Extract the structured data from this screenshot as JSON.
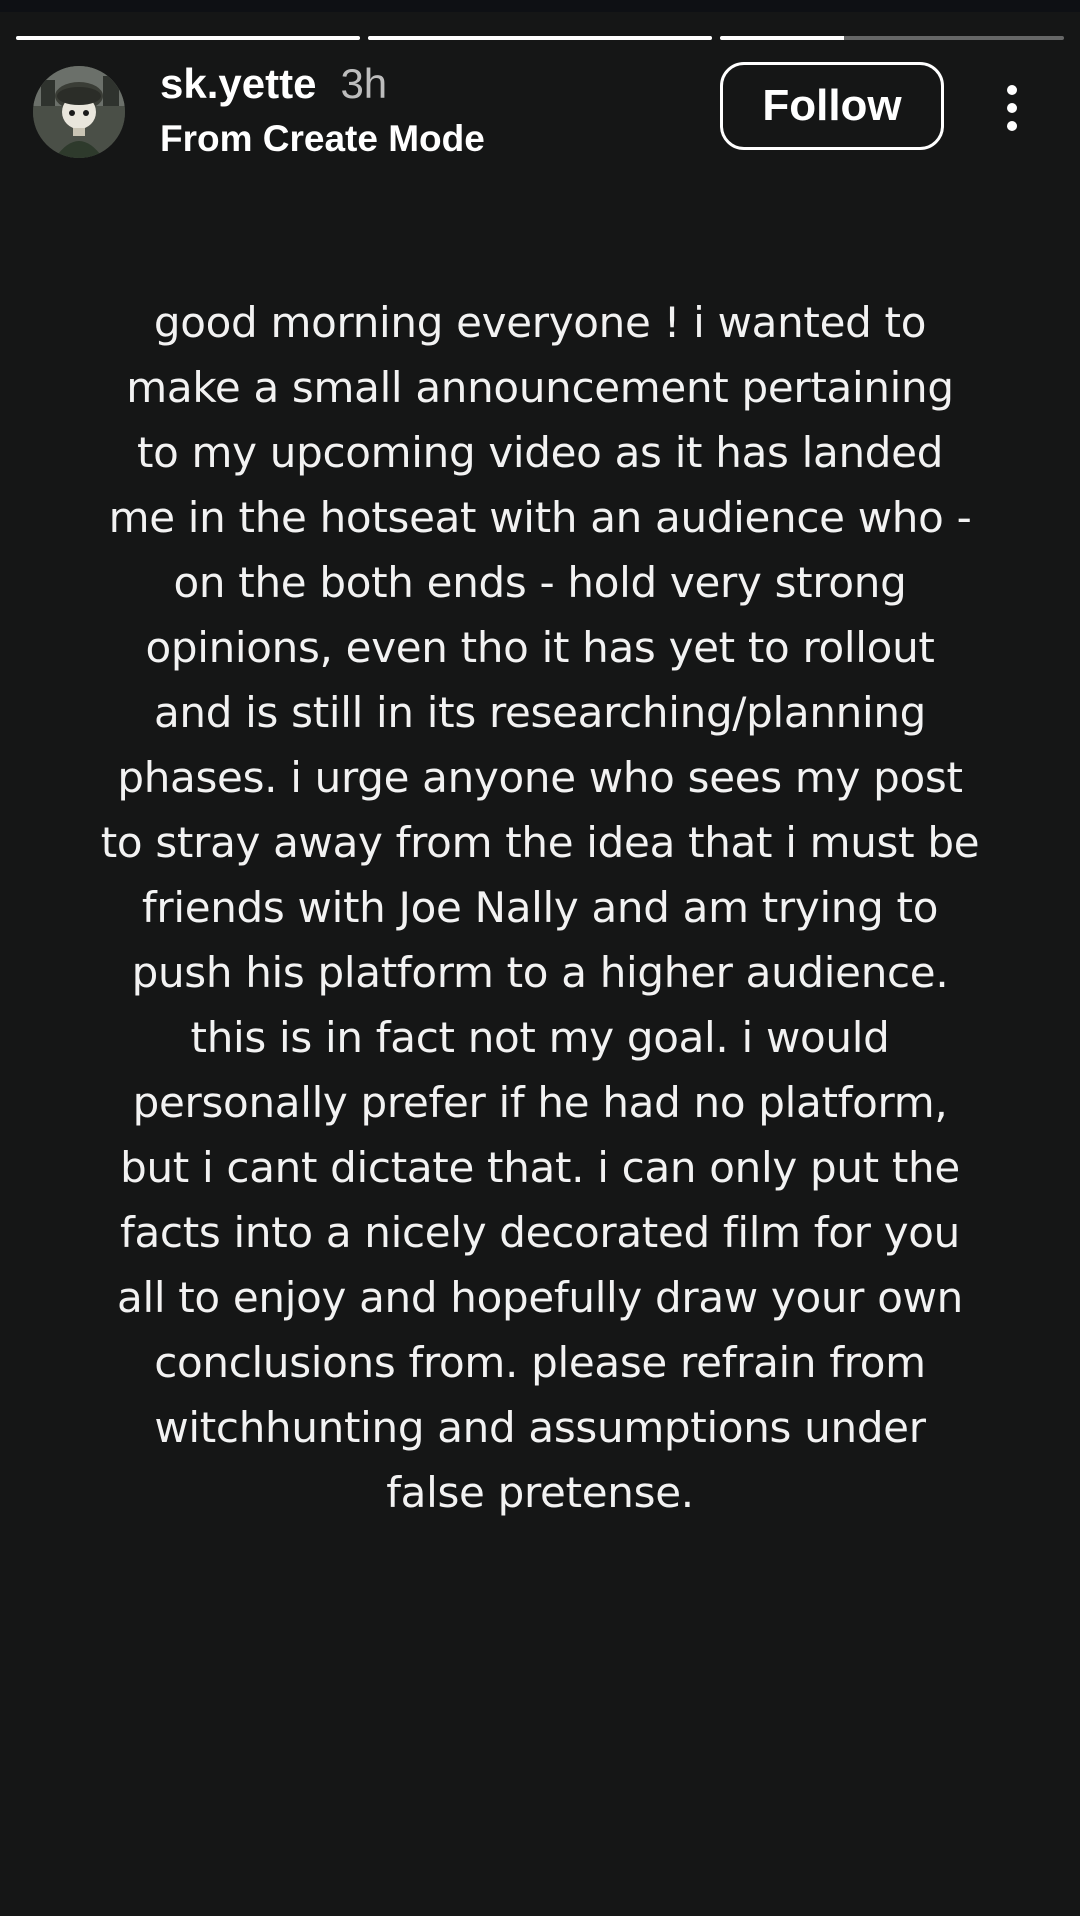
{
  "story": {
    "progress": [
      1.0,
      1.0,
      0.36
    ],
    "user": {
      "username": "sk.yette",
      "time_ago": "3h",
      "subtitle": "From Create Mode",
      "avatar_icon": "avatar-icon"
    },
    "follow_label": "Follow",
    "more_icon": "more-vertical-icon",
    "text": "good morning everyone ! i wanted to make a small announcement pertaining to my upcoming video as it has landed me in the hotseat with an audience who - on the both ends - hold very strong opinions, even tho it has yet to rollout and is still in its researching/planning phases. i urge anyone who sees my post to stray away from the idea that i must be friends with Joe Nally and am trying to push his platform to a higher audience. this is in fact not my goal. i would personally prefer if he had no platform, but i cant dictate that. i can only put the facts into a nicely decorated film for you all to enjoy and hopefully draw your own conclusions from. please refrain from witchhunting and assumptions under false pretense."
  },
  "colors": {
    "background": "#151616",
    "text": "#f2f2f2",
    "secondary_text": "#bdbdbd"
  }
}
